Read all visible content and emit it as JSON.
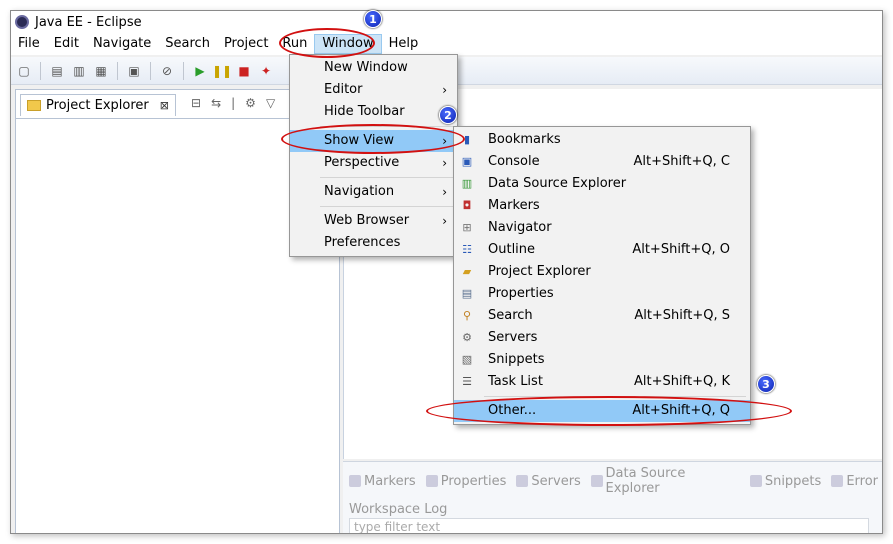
{
  "window": {
    "title": "Java EE - Eclipse"
  },
  "menubar": {
    "items": [
      "File",
      "Edit",
      "Navigate",
      "Search",
      "Project",
      "Run",
      "Window",
      "Help"
    ],
    "active": "Window"
  },
  "project_explorer": {
    "tab_label": "Project Explorer",
    "close_glyph": "⊠"
  },
  "window_menu": {
    "items": [
      {
        "label": "New Window",
        "submenu": false
      },
      {
        "label": "Editor",
        "submenu": true
      },
      {
        "label": "Hide Toolbar",
        "submenu": false
      },
      {
        "label": "Show View",
        "submenu": true,
        "highlight": true
      },
      {
        "label": "Perspective",
        "submenu": true
      },
      {
        "label": "Navigation",
        "submenu": true
      },
      {
        "label": "Web Browser",
        "submenu": true
      },
      {
        "label": "Preferences",
        "submenu": false
      }
    ],
    "arrow": "›"
  },
  "show_view_menu": {
    "items": [
      {
        "label": "Bookmarks",
        "shortcut": "",
        "icon": "bookmark-icon"
      },
      {
        "label": "Console",
        "shortcut": "Alt+Shift+Q, C",
        "icon": "console-icon"
      },
      {
        "label": "Data Source Explorer",
        "shortcut": "",
        "icon": "data-source-icon"
      },
      {
        "label": "Markers",
        "shortcut": "",
        "icon": "markers-icon"
      },
      {
        "label": "Navigator",
        "shortcut": "",
        "icon": "navigator-icon"
      },
      {
        "label": "Outline",
        "shortcut": "Alt+Shift+Q, O",
        "icon": "outline-icon"
      },
      {
        "label": "Project Explorer",
        "shortcut": "",
        "icon": "folder-icon"
      },
      {
        "label": "Properties",
        "shortcut": "",
        "icon": "properties-icon"
      },
      {
        "label": "Search",
        "shortcut": "Alt+Shift+Q, S",
        "icon": "search-icon"
      },
      {
        "label": "Servers",
        "shortcut": "",
        "icon": "servers-icon"
      },
      {
        "label": "Snippets",
        "shortcut": "",
        "icon": "snippets-icon"
      },
      {
        "label": "Task List",
        "shortcut": "Alt+Shift+Q, K",
        "icon": "task-list-icon"
      },
      {
        "label": "Other...",
        "shortcut": "Alt+Shift+Q, Q",
        "icon": "",
        "highlight": true
      }
    ]
  },
  "bottom_panel": {
    "tabs": [
      "Markers",
      "Properties",
      "Servers",
      "Data Source Explorer",
      "Snippets",
      "Error"
    ],
    "log_title": "Workspace Log",
    "filter_placeholder": "type filter text"
  },
  "annotations": {
    "step1": "1",
    "step2": "2",
    "step3": "3"
  },
  "colors": {
    "highlight": "#91c9f7",
    "annotation_red": "#d21010",
    "badge_blue": "#1030d0"
  }
}
